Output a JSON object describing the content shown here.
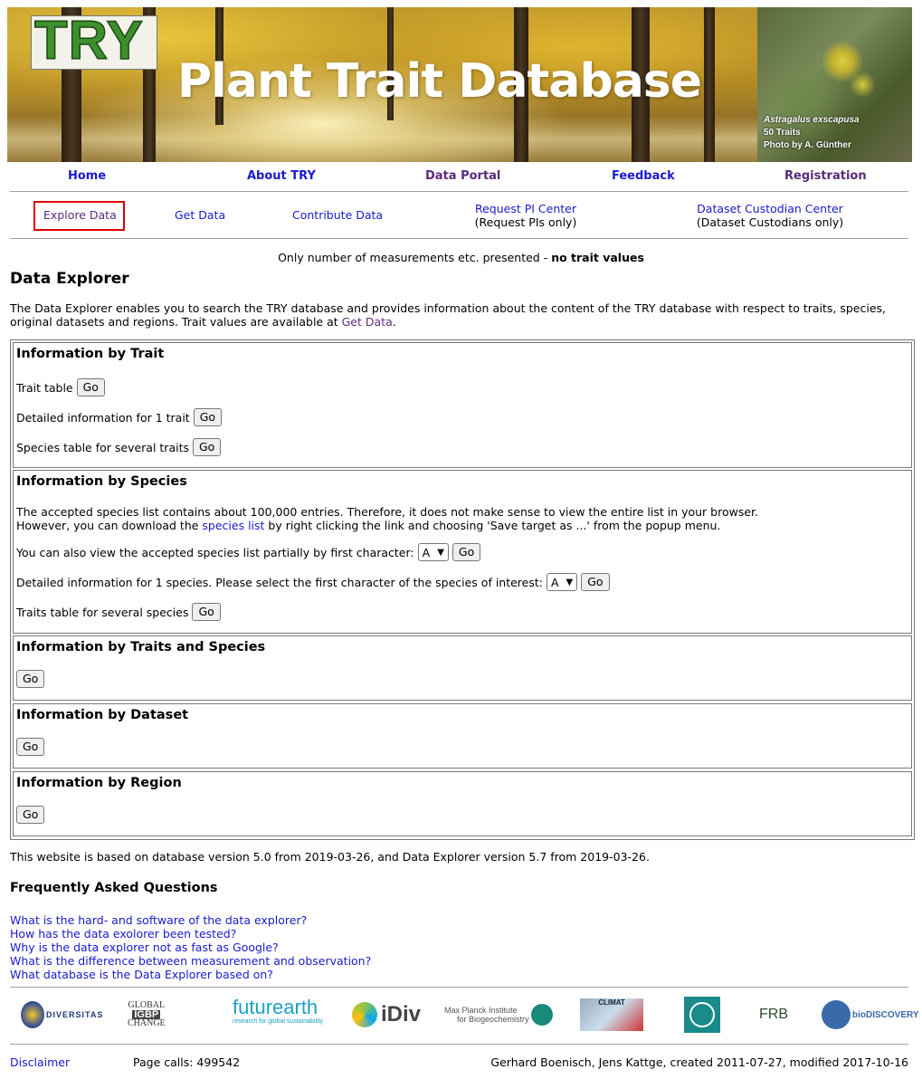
{
  "banner": {
    "logo_text": "TRY",
    "title": "Plant Trait Database",
    "photo_caption": [
      "Astragalus exscapusa",
      "50 Traits",
      "Photo by A. Günther"
    ]
  },
  "main_nav": [
    {
      "label": "Home"
    },
    {
      "label": "About TRY"
    },
    {
      "label": "Data Portal"
    },
    {
      "label": "Feedback"
    },
    {
      "label": "Registration"
    }
  ],
  "sub_nav": {
    "explore": "Explore Data",
    "get": "Get Data",
    "contribute": "Contribute Data",
    "pi_center": "Request PI Center",
    "pi_note": "(Request PIs only)",
    "custodian_center": "Dataset Custodian Center",
    "custodian_note": "(Dataset Custodians only)"
  },
  "notice": {
    "text": "Only number of measurements etc. presented - ",
    "bold": "no trait values"
  },
  "page_title": "Data Explorer",
  "intro": {
    "text": "The Data Explorer enables you to search the TRY database and provides information about the content of the TRY database with respect to traits, species, original datasets and regions. Trait values are available at ",
    "link": "Get Data",
    "end": "."
  },
  "sections": {
    "trait": {
      "title": "Information by Trait",
      "trait_table": "Trait table",
      "detailed_trait": "Detailed information for 1 trait",
      "species_table": "Species table for several traits"
    },
    "species": {
      "title": "Information by Species",
      "line1": "The accepted species list contains about 100,000 entries. Therefore, it does not make sense to view the entire list in your browser.",
      "line2_pre": "However, you can download the ",
      "line2_link": "species list",
      "line2_post": " by right clicking the link and choosing 'Save target as ...' from the popup menu.",
      "partial_label": "You can also view the accepted species list partially by first character:",
      "partial_select": "A",
      "detailed_label": "Detailed information for 1 species. Please select the first character of the species of interest:",
      "detailed_select": "A",
      "traits_table": "Traits table for several species"
    },
    "traits_species": {
      "title": "Information by Traits and Species"
    },
    "dataset": {
      "title": "Information by Dataset"
    },
    "region": {
      "title": "Information by Region"
    },
    "go_label": "Go"
  },
  "version_text": "This website is based on database version 5.0 from 2019-03-26, and Data Explorer version 5.7 from 2019-03-26.",
  "faq": {
    "title": "Frequently Asked Questions",
    "items": [
      "What is the hard- and software of the data explorer?",
      "How has the data exolorer been tested?",
      "Why is the data explorer not as fast as Google?",
      "What is the difference between measurement and observation?",
      "What database is the Data Explorer based on?"
    ]
  },
  "logos": {
    "diversitas": "DIVERSITAS",
    "igbp_top": "GLOBAL",
    "igbp_mid": "IGBP",
    "igbp_bot": "CHANGE",
    "futurearth": "futurearth",
    "futurearth_sub": "research for global sustainability",
    "idiv": "iDiv",
    "mpi_line1": "Max Planck Institute",
    "mpi_line2": "for Biogeochemistry",
    "climat": "CLIMAT",
    "frb": "FRB",
    "biodiscovery": "bioDISCOVERY"
  },
  "footer": {
    "disclaimer": "Disclaimer",
    "page_calls": "Page calls: 499542",
    "credits": "Gerhard Boenisch, Jens Kattge, created 2011-07-27, modified 2017-10-16"
  },
  "colors": {
    "link": "#1a1acc",
    "visited": "#5a2a7a",
    "highlight_box": "#e00000"
  }
}
